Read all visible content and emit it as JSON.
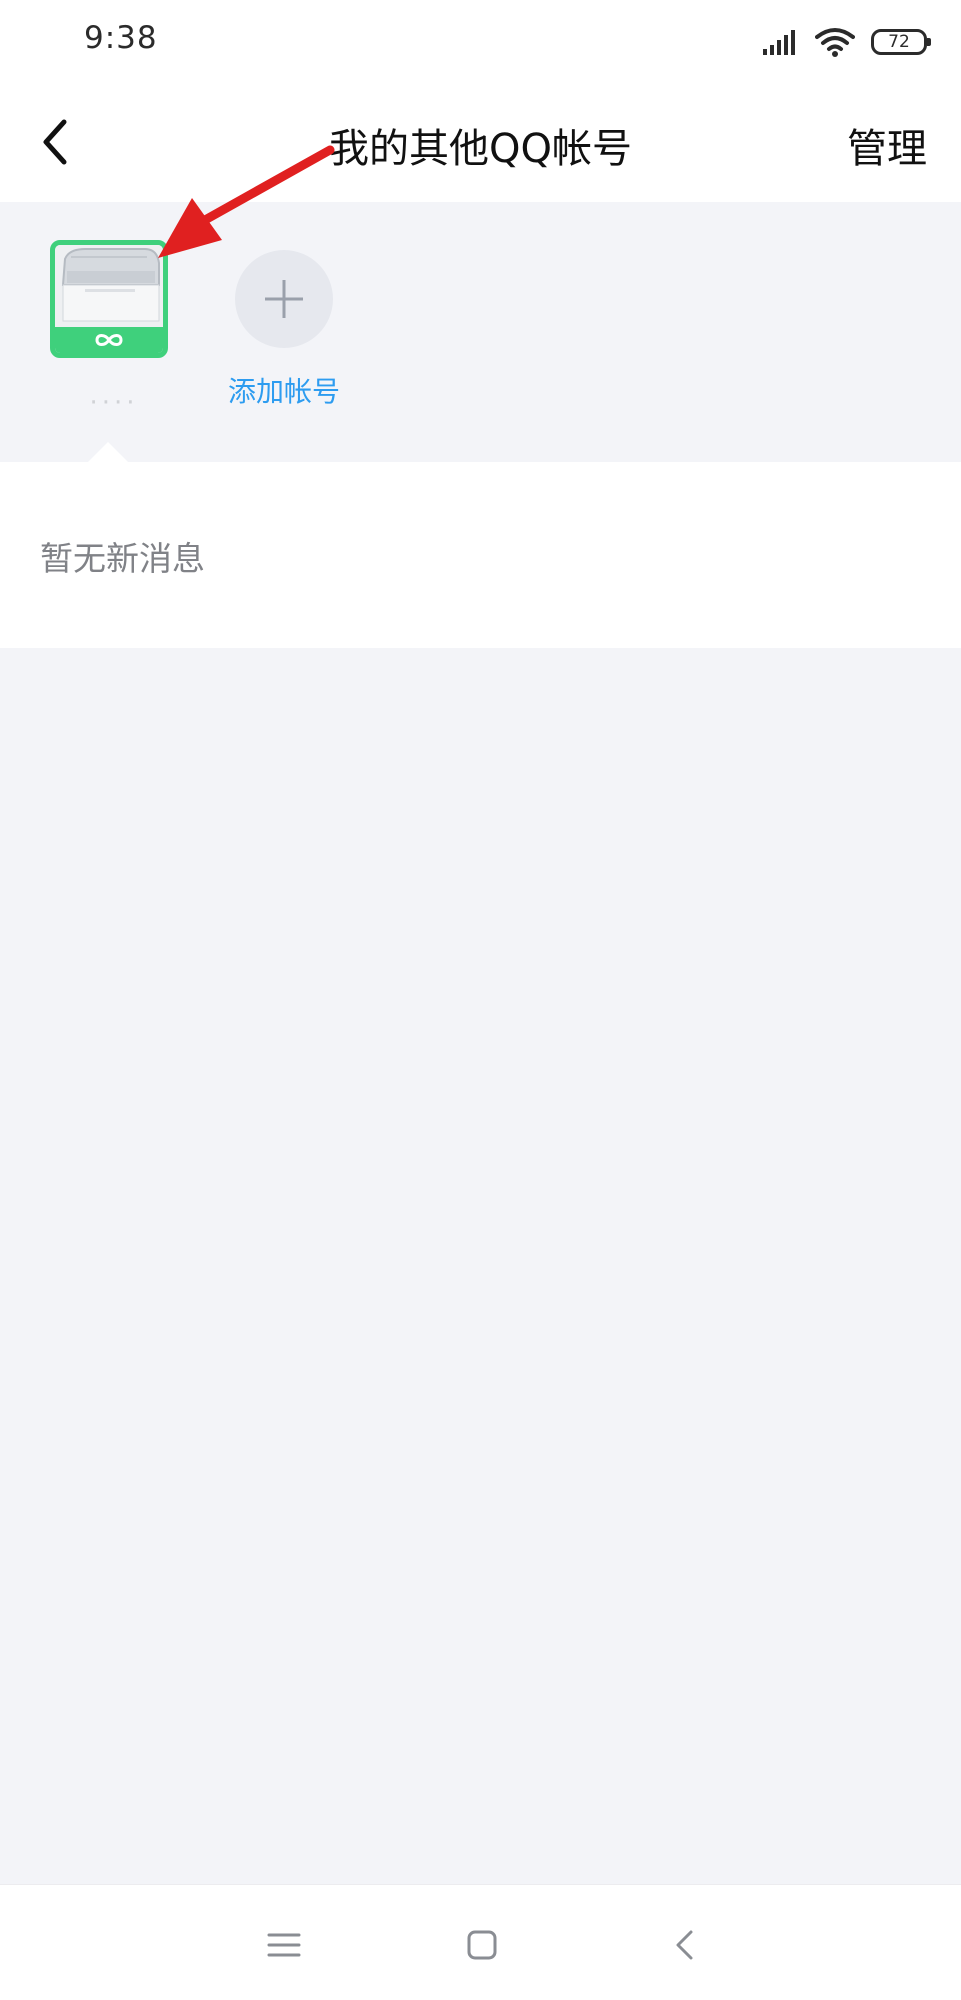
{
  "status_bar": {
    "time": "9:38",
    "battery": "72",
    "icons": [
      "signal-icon",
      "wifi-icon",
      "battery-icon"
    ]
  },
  "nav": {
    "title": "我的其他QQ帐号",
    "manage_label": "管理",
    "back_icon": "back-chevron-icon"
  },
  "accounts": {
    "current": {
      "avatar": "freezer-photo-avatar",
      "badge_icon": "infinity-icon",
      "name_masked": "····"
    },
    "add_label": "添加帐号",
    "add_icon": "plus-icon"
  },
  "messages": {
    "empty_text": "暂无新消息"
  },
  "system_nav": {
    "icons": [
      "menu-icon",
      "home-icon",
      "back-icon"
    ]
  },
  "colors": {
    "accent_blue": "#2d9cf0",
    "avatar_green": "#3fd07c",
    "annotation_red": "#e02020",
    "page_bg": "#f3f4f8"
  }
}
